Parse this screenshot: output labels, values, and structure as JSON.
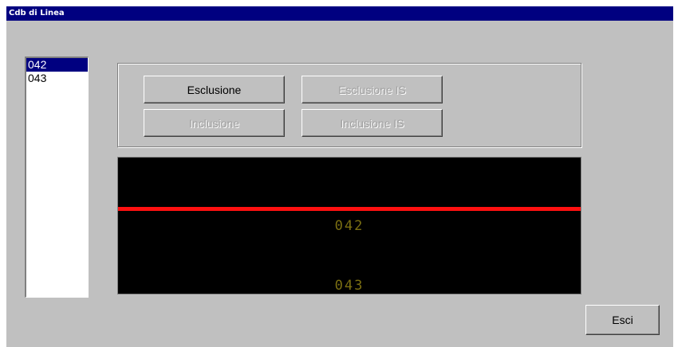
{
  "window": {
    "title": "Cdb di Linea"
  },
  "cdb_list": {
    "items": [
      "042",
      "043"
    ],
    "selected_index": 0
  },
  "actions": {
    "esclusione": {
      "label": "Esclusione",
      "enabled": true
    },
    "esclusione_is": {
      "label": "Esclusione IS",
      "enabled": false
    },
    "inclusione": {
      "label": "Inclusione",
      "enabled": false
    },
    "inclusione_is": {
      "label": "Inclusione IS",
      "enabled": false
    }
  },
  "display": {
    "line_color": "#ff1010",
    "label_color": "#7b6f12",
    "labels": [
      "042",
      "043"
    ]
  },
  "exit_label": "Esci"
}
